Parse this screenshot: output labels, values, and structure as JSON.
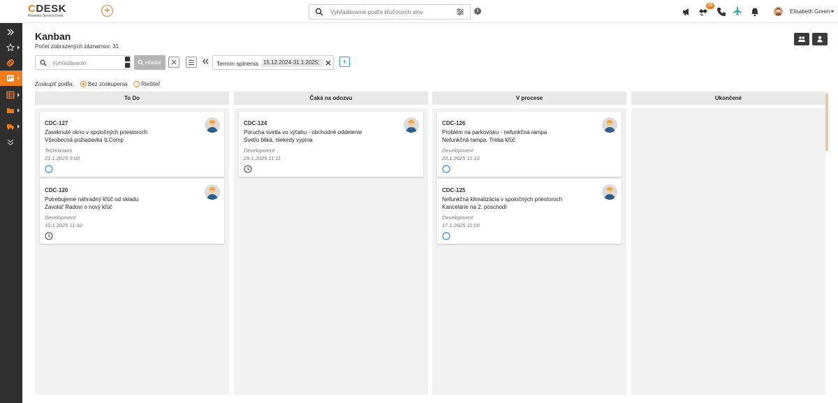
{
  "brand": {
    "logo_text": "CDESK",
    "tagline": "Powerful Service Desk",
    "accent_color": "#f07c1b"
  },
  "topbar": {
    "search_placeholder": "Vyhľadávanie podľa kľúčových slov",
    "notification_count": "20",
    "user_name": "Elisabeth Green"
  },
  "page": {
    "title": "Kanban",
    "record_count": "Počet zobrazených záznamov: 31"
  },
  "filters": {
    "search_placeholder": "Vyhľadávanie",
    "search_button": "Hľadať",
    "chip_label": "Termín splnenia",
    "chip_value": "15.12.2024-31.1.2025;"
  },
  "group_by": {
    "label": "Zoskupiť podľa:",
    "options": [
      {
        "label": "Bez zoskupenia",
        "selected": true
      },
      {
        "label": "Riešiteľ",
        "selected": false
      }
    ]
  },
  "columns": [
    {
      "title": "To Do",
      "cards": [
        {
          "id": "CDC-127",
          "line1": "Zaseknuté okno v spoločných priestoroch",
          "line2": "Všeobecná požiadavka ILComp",
          "team": "Technicians",
          "date": "21.1.2025 9:00",
          "status_icon": "circle-icon"
        },
        {
          "id": "CDC-120",
          "line1": "Potrebujeme náhradný kľúč od skladu",
          "line2": "Zavolať Radovi o nový kľúč",
          "team": "Development",
          "date": "10.1.2025 11:10",
          "status_icon": "clock-icon"
        }
      ]
    },
    {
      "title": "Čaká na odozvu",
      "cards": [
        {
          "id": "CDC-124",
          "line1": "Porucha svetla vo výťahu - obchodné oddelenie",
          "line2": "Svetlo bliká, niekedy vypína",
          "team": "Development",
          "date": "29.1.2025 11:11",
          "status_icon": "clock-icon"
        }
      ]
    },
    {
      "title": "V procese",
      "cards": [
        {
          "id": "CDC-126",
          "line1": "Problém na parkovisku - nefunkčná rampa",
          "line2": "Nefunkčná rampa. Treba kľúč",
          "team": "Development",
          "date": "20.1.2025 11:10",
          "status_icon": "circle-icon"
        },
        {
          "id": "CDC-125",
          "line1": "Nefunkčná klimatizácia v spoločných priestoroch",
          "line2": "Kancelárie na 2. poschodí",
          "team": "Development",
          "date": "17.1.2025 11:09",
          "status_icon": "circle-icon"
        }
      ]
    },
    {
      "title": "Ukončené",
      "cards": []
    }
  ]
}
